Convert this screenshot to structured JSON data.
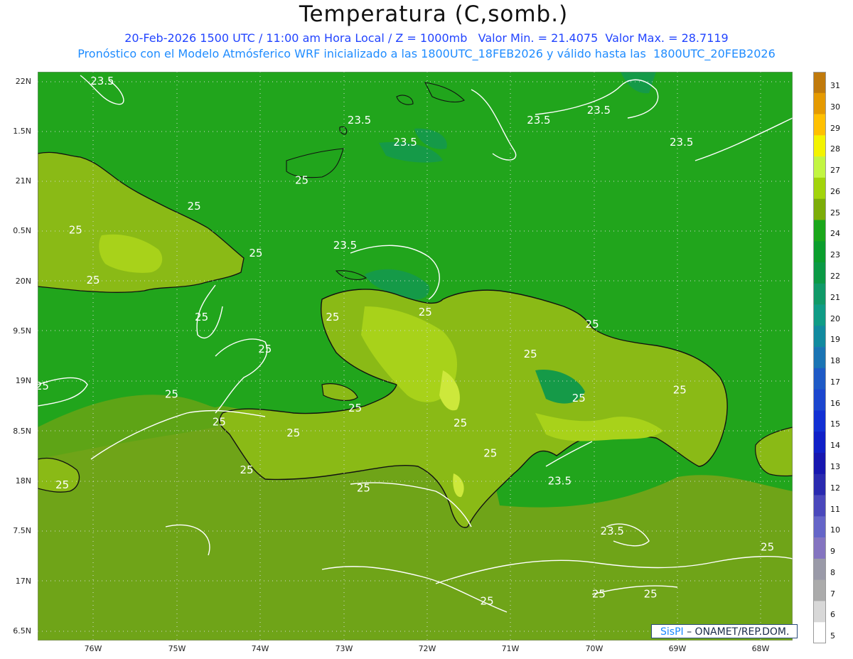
{
  "header": {
    "title": "Temperatura (C,somb.)",
    "line1": "20-Feb-2026 1500 UTC / 11:00 am Hora Local / Z = 1000mb   Valor Min. = 21.4075  Valor Max. = 28.7119",
    "line2": "Pronóstico con el Modelo Atmósferico WRF inicializado a las 1800UTC_18FEB2026 y válido hasta las  1800UTC_20FEB2026"
  },
  "axes": {
    "lat_labels": [
      "22N",
      "1.5N",
      "21N",
      "0.5N",
      "20N",
      "9.5N",
      "19N",
      "8.5N",
      "18N",
      "7.5N",
      "17N",
      "6.5N"
    ],
    "lon_labels": [
      "76W",
      "75W",
      "74W",
      "73W",
      "72W",
      "71W",
      "70W",
      "69W",
      "68W"
    ]
  },
  "map": {
    "contour_labels": [
      {
        "text": "23.5",
        "lon": -75.89,
        "lat": 21.97
      },
      {
        "text": "23.5",
        "lon": -72.26,
        "lat": 21.36
      },
      {
        "text": "23.5",
        "lon": -72.81,
        "lat": 21.58
      },
      {
        "text": "23.5",
        "lon": -70.66,
        "lat": 21.58
      },
      {
        "text": "23.5",
        "lon": -69.94,
        "lat": 21.68
      },
      {
        "text": "23.5",
        "lon": -68.95,
        "lat": 21.36
      },
      {
        "text": "23.5",
        "lon": -72.98,
        "lat": 20.33
      },
      {
        "text": "23.5",
        "lon": -70.41,
        "lat": 17.97
      },
      {
        "text": "23.5",
        "lon": -69.78,
        "lat": 17.47
      },
      {
        "text": "25",
        "lon": -73.5,
        "lat": 20.98
      },
      {
        "text": "25",
        "lon": -74.79,
        "lat": 20.72
      },
      {
        "text": "25",
        "lon": -76.21,
        "lat": 20.48
      },
      {
        "text": "25",
        "lon": -74.05,
        "lat": 20.25
      },
      {
        "text": "25",
        "lon": -76.0,
        "lat": 19.98
      },
      {
        "text": "25",
        "lon": -74.7,
        "lat": 19.61
      },
      {
        "text": "25",
        "lon": -73.94,
        "lat": 19.29
      },
      {
        "text": "25",
        "lon": -73.13,
        "lat": 19.61
      },
      {
        "text": "25",
        "lon": -72.02,
        "lat": 19.66
      },
      {
        "text": "25",
        "lon": -70.02,
        "lat": 19.54
      },
      {
        "text": "25",
        "lon": -70.76,
        "lat": 19.24
      },
      {
        "text": "25",
        "lon": -76.61,
        "lat": 18.92
      },
      {
        "text": "25",
        "lon": -75.06,
        "lat": 18.84
      },
      {
        "text": "25",
        "lon": -72.86,
        "lat": 18.7
      },
      {
        "text": "25",
        "lon": -70.18,
        "lat": 18.8
      },
      {
        "text": "25",
        "lon": -68.97,
        "lat": 18.88
      },
      {
        "text": "25",
        "lon": -74.49,
        "lat": 18.56
      },
      {
        "text": "25",
        "lon": -73.6,
        "lat": 18.45
      },
      {
        "text": "25",
        "lon": -71.6,
        "lat": 18.55
      },
      {
        "text": "25",
        "lon": -71.24,
        "lat": 18.25
      },
      {
        "text": "25",
        "lon": -74.16,
        "lat": 18.08
      },
      {
        "text": "25",
        "lon": -72.76,
        "lat": 17.9
      },
      {
        "text": "25",
        "lon": -76.37,
        "lat": 17.93
      },
      {
        "text": "25",
        "lon": -67.92,
        "lat": 17.31
      },
      {
        "text": "25",
        "lon": -71.28,
        "lat": 16.77
      },
      {
        "text": "25",
        "lon": -69.94,
        "lat": 16.84
      },
      {
        "text": "25",
        "lon": -69.32,
        "lat": 16.84
      }
    ]
  },
  "colorbar": {
    "labels": [
      "31",
      "30",
      "29",
      "28",
      "27",
      "26",
      "25",
      "24",
      "23",
      "22",
      "21",
      "20",
      "19",
      "18",
      "17",
      "16",
      "15",
      "14",
      "13",
      "12",
      "11",
      "10",
      "9",
      "8",
      "7",
      "6",
      "5"
    ],
    "colors": [
      "#c07a0c",
      "#e59a00",
      "#ffc000",
      "#f3f300",
      "#c2f542",
      "#a2d40b",
      "#7cad08",
      "#1aa71a",
      "#0b9e2d",
      "#0b9a45",
      "#109a68",
      "#0f9c86",
      "#118a9f",
      "#1a74b4",
      "#1e5ac6",
      "#1b46cf",
      "#1230d4",
      "#1020c8",
      "#1717b0",
      "#2a2ab0",
      "#4a48bc",
      "#6565c8",
      "#8474c0",
      "#9a9aa8",
      "#ababab",
      "#d8d8d8",
      "#ffffff"
    ]
  },
  "logo": {
    "sis": "SisPI",
    "rest": "– ONAMET/REP.DOM."
  },
  "colors": {
    "ocean": "#21a51c",
    "ocean_south": "#6fa418",
    "land": "#8aba16",
    "land_highlight": "#a8d21a",
    "peak": "#cde83b",
    "cool_ocean": "#159a48",
    "contour": "#ffffff",
    "grid": "#cfd8cf"
  }
}
